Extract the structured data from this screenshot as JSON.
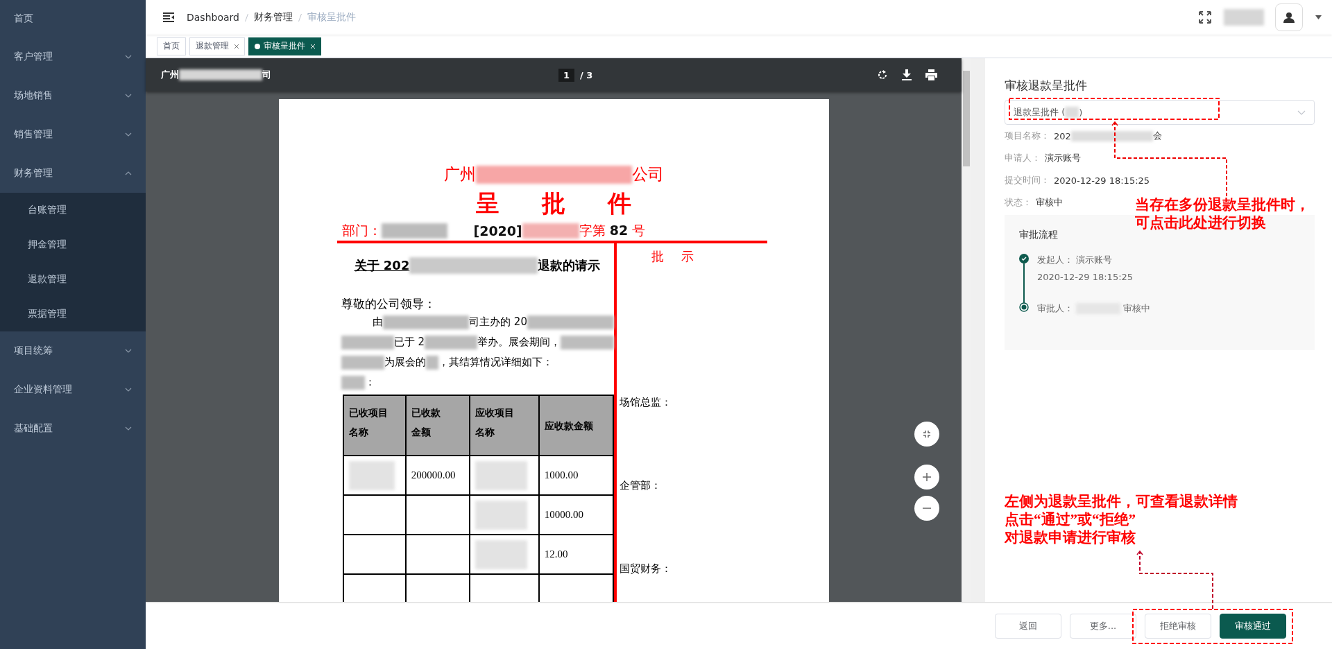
{
  "sidebar": {
    "items": [
      {
        "kind": "link",
        "label": "首页"
      },
      {
        "kind": "group",
        "label": "客户管理",
        "expanded": false
      },
      {
        "kind": "group",
        "label": "场地销售",
        "expanded": false
      },
      {
        "kind": "group",
        "label": "销售管理",
        "expanded": false
      },
      {
        "kind": "group",
        "label": "财务管理",
        "expanded": true,
        "children": [
          {
            "label": "台账管理"
          },
          {
            "label": "押金管理"
          },
          {
            "label": "退款管理"
          },
          {
            "label": "票据管理"
          }
        ]
      },
      {
        "kind": "group",
        "label": "项目统筹",
        "expanded": false
      },
      {
        "kind": "group",
        "label": "企业资料管理",
        "expanded": false
      },
      {
        "kind": "group",
        "label": "基础配置",
        "expanded": false
      }
    ]
  },
  "header": {
    "breadcrumb": [
      "Dashboard",
      "财务管理",
      "审核呈批件"
    ]
  },
  "tabs": [
    {
      "label": "首页",
      "closable": false,
      "selected": false
    },
    {
      "label": "退款管理",
      "closable": true,
      "selected": false
    },
    {
      "label": "审核呈批件",
      "closable": true,
      "selected": true
    }
  ],
  "pdf_viewer": {
    "title_parts": [
      "广州",
      "司"
    ],
    "page": "1",
    "page_total": "/ 3",
    "document": {
      "company_parts": [
        "广州",
        "公司"
      ],
      "title": "呈批件",
      "dept_label": "部门：",
      "doc_year": "[2020]",
      "doc_number": "字第 **82** 号",
      "approval_heading": "批示",
      "request_title_parts": [
        "关于 202",
        "退款的请示"
      ],
      "salutation": "尊敬的公司领导：",
      "paragraph_lines": [
        [
          {
            "kind": "text",
            "text": "由"
          },
          {
            "kind": "redacted"
          },
          {
            "kind": "text",
            "text": "司主办的 20"
          },
          {
            "kind": "redacted"
          }
        ],
        [
          {
            "kind": "redacted"
          },
          {
            "kind": "text",
            "text": "已于 2"
          },
          {
            "kind": "redacted"
          },
          {
            "kind": "text",
            "text": "举办。展会期间，"
          },
          {
            "kind": "redacted"
          }
        ],
        [
          {
            "kind": "redacted"
          },
          {
            "kind": "text",
            "text": "为展会的"
          },
          {
            "kind": "redacted"
          },
          {
            "kind": "text",
            "text": "，其结算情况详细如下："
          }
        ],
        [
          {
            "kind": "redacted"
          },
          {
            "kind": "text",
            "text": "："
          }
        ]
      ],
      "table": {
        "columns": [
          "已收项目名称",
          "已收款金额",
          "应收项目名称",
          "应收款金额"
        ],
        "rows": [
          [
            {
              "kind": "redacted"
            },
            {
              "kind": "text",
              "text": "200000.00"
            },
            {
              "kind": "redacted"
            },
            {
              "kind": "text",
              "text": "1000.00"
            }
          ],
          [
            {
              "kind": "empty"
            },
            {
              "kind": "empty"
            },
            {
              "kind": "redacted"
            },
            {
              "kind": "text",
              "text": "10000.00"
            }
          ],
          [
            {
              "kind": "empty"
            },
            {
              "kind": "empty"
            },
            {
              "kind": "redacted"
            },
            {
              "kind": "text",
              "text": "12.00"
            }
          ],
          [
            {
              "kind": "empty"
            },
            {
              "kind": "empty"
            },
            {
              "kind": "empty"
            },
            {
              "kind": "empty"
            }
          ]
        ]
      },
      "signers": [
        "场馆总监：",
        "企管部：",
        "国贸财务："
      ]
    }
  },
  "review_panel": {
    "title": "审核退款呈批件",
    "select_parts": [
      "退款呈批件 (",
      ")"
    ],
    "fields": [
      {
        "label": "项目名称：",
        "value_parts": [
          "202",
          "会"
        ]
      },
      {
        "label": "申请人：",
        "value_parts": [
          "演示账号"
        ]
      },
      {
        "label": "提交时间：",
        "value_parts": [
          "2020-12-29 18:15:25"
        ]
      },
      {
        "label": "状态：",
        "value_parts": [
          "审核中"
        ]
      }
    ],
    "flow": {
      "title": "审批流程",
      "steps": [
        {
          "completed": true,
          "label": "发起人：",
          "name": "演示账号",
          "time": "2020-12-29 18:15:25"
        },
        {
          "completed": false,
          "label": "审批人：",
          "state": "审核中"
        }
      ]
    }
  },
  "footer": {
    "buttons": [
      {
        "label": "返回",
        "kind": "default"
      },
      {
        "label": "更多...",
        "kind": "default"
      },
      {
        "label": "拒绝审核",
        "kind": "default"
      },
      {
        "label": "审核通过",
        "kind": "primary"
      }
    ]
  },
  "annotations": [
    {
      "lines": [
        "当存在多份退款呈批件时，",
        "可点击此处进行切换"
      ]
    },
    {
      "lines": [
        "左侧为退款呈批件，可查看退款详情",
        "点击“通过”或“拒绝”",
        "对退款申请进行审核"
      ]
    }
  ]
}
